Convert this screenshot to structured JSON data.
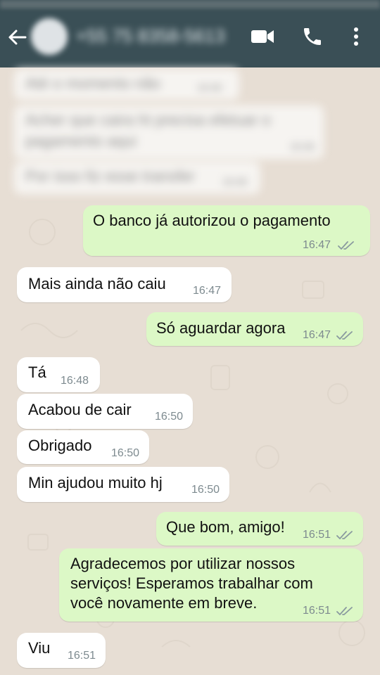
{
  "header": {
    "contact_name": "+55 75 8358-5613"
  },
  "blurred_messages": [
    {
      "text": "Até o momento não",
      "time": "16:46"
    },
    {
      "text": "Acher que caira ht precisa efetuar o",
      "text2": "pagamento aqui",
      "time": "16:46"
    },
    {
      "text": "Por isso fiz esse transfer",
      "time": "16:46"
    }
  ],
  "messages": [
    {
      "direction": "outgoing",
      "text": "O banco já autorizou o pagamento",
      "time": "16:47",
      "ticks": "double-check"
    },
    {
      "direction": "incoming",
      "text": "Mais ainda não caiu",
      "time": "16:47"
    },
    {
      "direction": "outgoing",
      "text": "Só aguardar agora",
      "time": "16:47",
      "ticks": "double-check"
    },
    {
      "direction": "incoming",
      "text": "Tá",
      "time": "16:48"
    },
    {
      "direction": "incoming",
      "text": "Acabou de cair",
      "time": "16:50"
    },
    {
      "direction": "incoming",
      "text": "Obrigado",
      "time": "16:50"
    },
    {
      "direction": "incoming",
      "text": "Min ajudou muito hj",
      "time": "16:50"
    },
    {
      "direction": "outgoing",
      "text": "Que bom, amigo!",
      "time": "16:51",
      "ticks": "double-check"
    },
    {
      "direction": "outgoing",
      "lines": [
        "Agradecemos por utilizar nossos",
        "serviços! Esperamos trabalhar com",
        "você novamente em breve."
      ],
      "time": "16:51",
      "ticks": "double-check"
    },
    {
      "direction": "incoming",
      "text": "Viu",
      "time": "16:51"
    }
  ],
  "colors": {
    "header": "#3a4f56",
    "chat_background": "#e7ded4",
    "incoming_bubble": "#ffffff",
    "outgoing_bubble": "#dcf8c6",
    "timestamp": "#7d8a8f"
  }
}
